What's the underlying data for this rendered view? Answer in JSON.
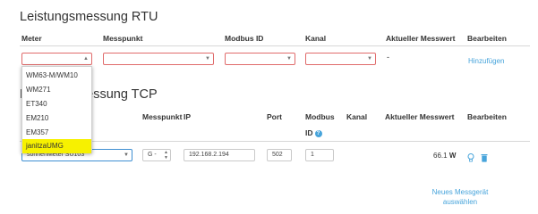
{
  "rtu": {
    "title": "Leistungsmessung RTU",
    "headers": {
      "meter": "Meter",
      "messpunkt": "Messpunkt",
      "modbus_id": "Modbus ID",
      "kanal": "Kanal",
      "aktueller_messwert": "Aktueller Messwert",
      "bearbeiten": "Bearbeiten"
    },
    "messwert": "-",
    "add_link": "Hinzufügen",
    "meter_options": [
      "WM63-M/WM10",
      "WM271",
      "ET340",
      "EM210",
      "EM357",
      "janitzaUMG"
    ]
  },
  "tcp": {
    "title_partial": "Leistungsmessung TCP",
    "headers": {
      "messpunkt": "Messpunkt",
      "ip": "IP",
      "port": "Port",
      "modbus": "Modbus",
      "id": "ID",
      "help_icon": "?",
      "kanal": "Kanal",
      "aktueller_messwert": "Aktueller Messwert",
      "bearbeiten": "Bearbeiten"
    },
    "row": {
      "meter": "sonnenMeter SU103",
      "messpunkt": "G -",
      "ip": "192.168.2.194",
      "port": "502",
      "modbus_id": "1",
      "value": "66.1",
      "unit": "W"
    },
    "new_device_link_line1": "Neues Messgerät",
    "new_device_link_line2": "auswählen"
  },
  "icons": {
    "bulb": "lightbulb-icon",
    "trash": "trash-icon"
  },
  "colors": {
    "accent": "#47a4db",
    "error_border": "#e06b6b",
    "highlight": "#f7f100"
  }
}
